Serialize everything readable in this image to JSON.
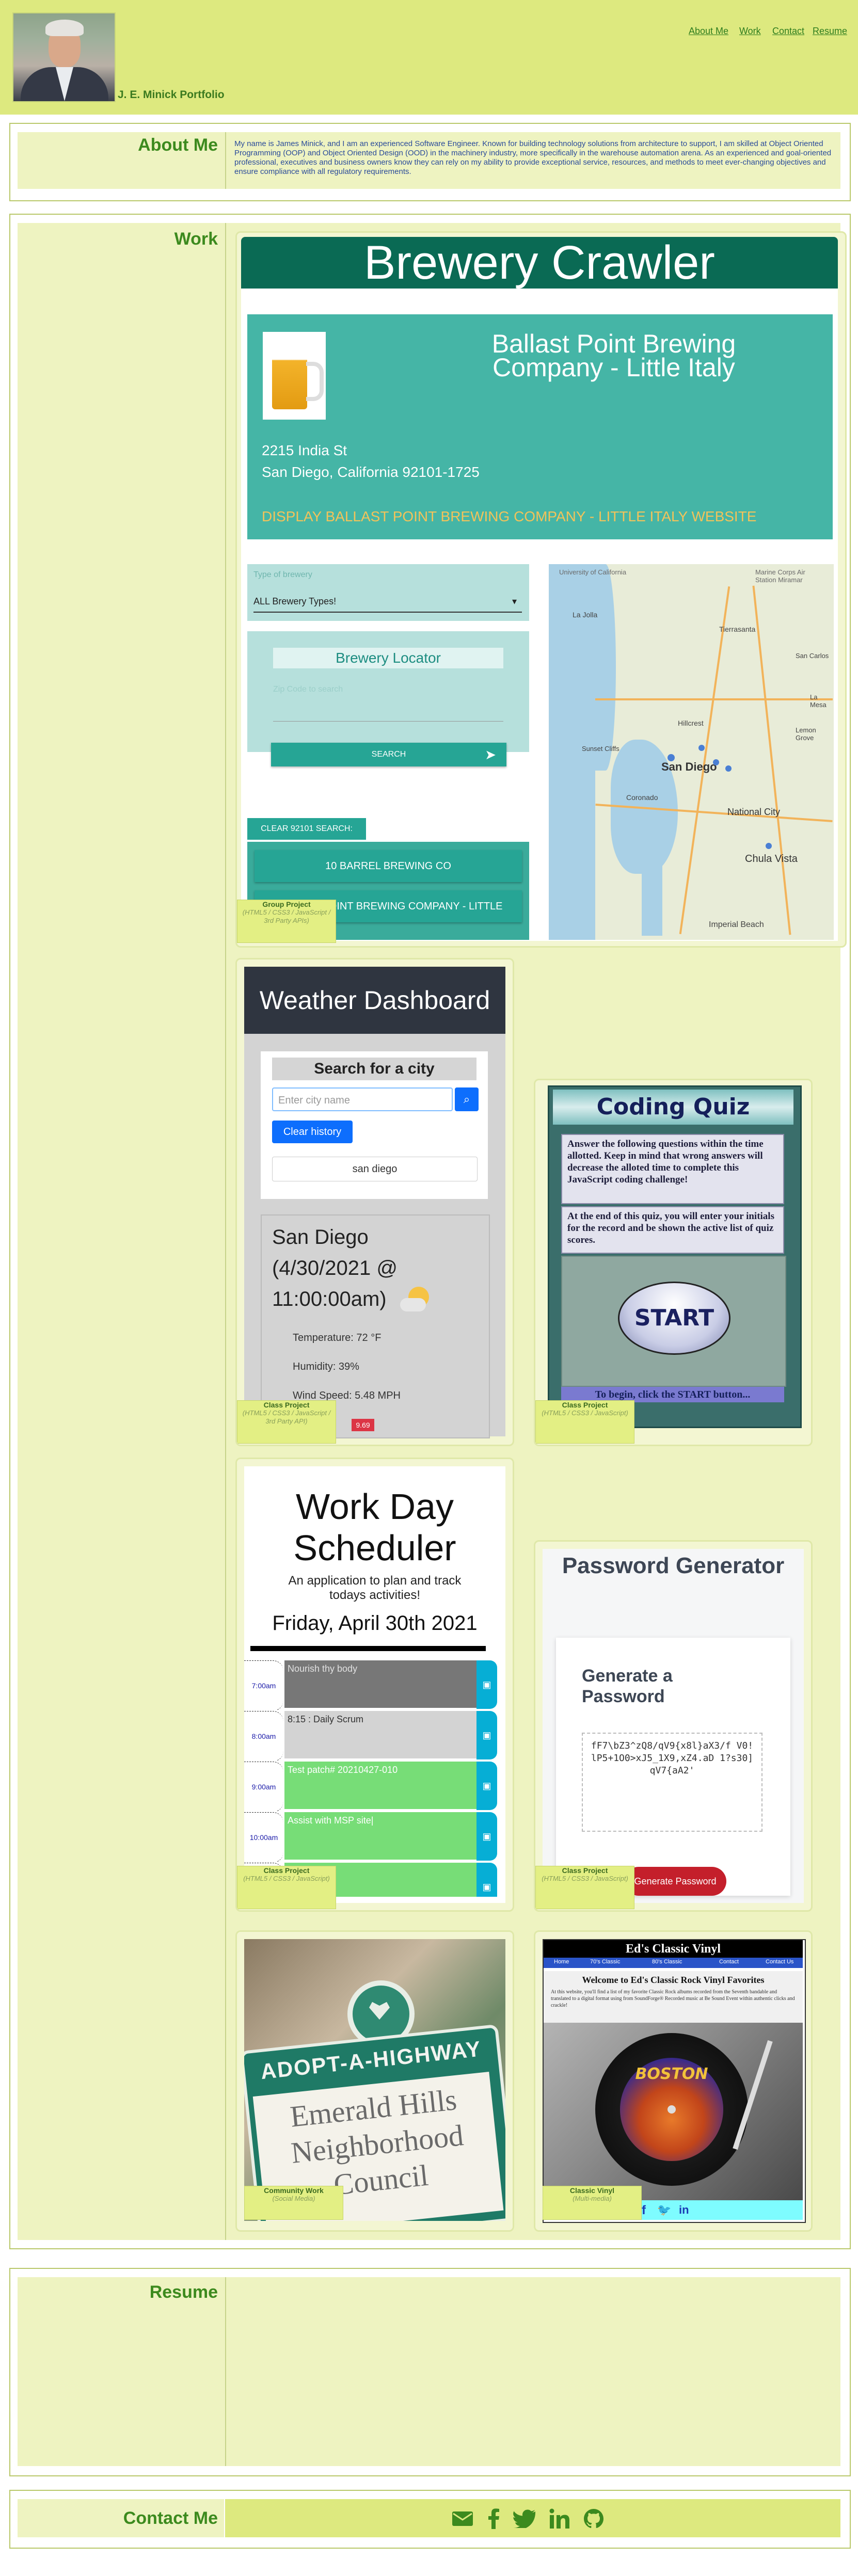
{
  "header": {
    "brand": "J. E. Minick Portfolio",
    "nav": [
      "About Me",
      "Work",
      "Contact",
      "Resume"
    ]
  },
  "about": {
    "heading": "About Me",
    "text": "My name is James Minick, and I am an experienced Software Engineer. Known for building technology solutions from architecture to support, I am skilled at Object Oriented Programming (OOP) and Object Oriented Design (OOD) in the machinery industry, more specifically in the warehouse automation arena. As an experienced and goal-oriented professional, executives and business owners know they can rely on my ability to provide exceptional service, resources, and methods to meet ever-changing objectives and ensure compliance with all regulatory requirements."
  },
  "work": {
    "heading": "Work",
    "brewery": {
      "title": "Brewery Crawler",
      "name": "Ballast Point Brewing Company - Little Italy",
      "address1": "2215 India St",
      "address2": "San Diego, California 92101-1725",
      "link": "DISPLAY BALLAST POINT BREWING COMPANY - LITTLE ITALY WEBSITE",
      "type_label": "Type of brewery",
      "type_value": "ALL Brewery Types!",
      "locator_title": "Brewery Locator",
      "zip_placeholder": "Zip Code to search",
      "search_button": "SEARCH",
      "clear_button": "CLEAR 92101 SEARCH:",
      "results": [
        "10 BARREL BREWING CO",
        "BALLAST POINT BREWING COMPANY - LITTLE"
      ],
      "map_labels": [
        "University of California",
        "Marine Corps Air Station Miramar",
        "La Jolla",
        "Tierrasanta",
        "San Carlos",
        "La Mesa",
        "Hillcrest",
        "Lemon Grove",
        "Sunset Cliffs",
        "San Diego",
        "Coronado",
        "National City",
        "Chula Vista",
        "Imperial Beach"
      ],
      "tag_title": "Group Project",
      "tag_sub": "(HTML5 / CSS3 / JavaScript / 3rd Party APIs)"
    },
    "weather": {
      "title": "Weather Dashboard",
      "search_title": "Search for a city",
      "input_placeholder": "Enter city name",
      "clear_button": "Clear history",
      "history_item": "san diego",
      "city": "San Diego",
      "date": "(4/30/2021 @",
      "time": "11:00:00am)",
      "temp": "Temperature: 72 °F",
      "humidity": "Humidity: 39%",
      "wind": "Wind Speed: 5.48 MPH",
      "uv": "9.69",
      "tag_title": "Class Project",
      "tag_sub": "(HTML5 / CSS3 / JavaScript / 3rd Party API)"
    },
    "quiz": {
      "title": "Coding Quiz",
      "para1": "Answer the following questions within the time allotted. Keep in mind that wrong answers will decrease the alloted time to complete this JavaScript coding challenge!",
      "para2": "At the end of this quiz, you will enter your initials for the record and be shown the active list of quiz scores.",
      "start": "START",
      "footer": "To begin, click the START button...",
      "tag_title": "Class Project",
      "tag_sub": "(HTML5 / CSS3 / JavaScript)"
    },
    "scheduler": {
      "title": "Work Day Scheduler",
      "subtitle": "An application to plan and track todays activities!",
      "date": "Friday, April 30th 2021",
      "rows": [
        {
          "time": "7:00am",
          "text": "Nourish thy body",
          "state": "past"
        },
        {
          "time": "8:00am",
          "text": "8:15 : Daily Scrum",
          "state": "present"
        },
        {
          "time": "9:00am",
          "text": "Test patch# 20210427-010",
          "state": "future"
        },
        {
          "time": "10:00am",
          "text": "Assist with MSP site|",
          "state": "future"
        },
        {
          "time": "11:00am",
          "text": "",
          "state": "future"
        }
      ],
      "tag_title": "Class Project",
      "tag_sub": "(HTML5 / CSS3 / JavaScript)"
    },
    "password": {
      "title": "Password Generator",
      "card_title": "Generate a Password",
      "output": "fF7\\bZ3^zQ8/qV9{x8l}aX3/f V0!lP5+1O0>xJ5_1X9,xZ4.aD 1?s30]qV7{aA2'",
      "button": "Generate Password",
      "tag_title": "Class Project",
      "tag_sub": "(HTML5 / CSS3 / JavaScript)"
    },
    "adopt": {
      "sign_top": "ADOPT-A-HIGHWAY",
      "sign_line1": "Emerald Hills",
      "sign_line2": "Neighborhood",
      "sign_line3": "Council",
      "tag_title": "Community Work",
      "tag_sub": "(Social Media)"
    },
    "vinyl": {
      "title": "Ed's Classic Vinyl",
      "nav": [
        "Home",
        "70's Classic",
        "80's Classic",
        "Contact",
        "Contact Us"
      ],
      "welcome": "Welcome to Ed's Classic Rock Vinyl Favorites",
      "blurb": "At this website, you'll find a list of my favorite Classic Rock albums recorded from the Seventh bandable and translated to a digital format using from SoundForge® Recorded music at Be Sound Event within authentic clicks and crackle!",
      "album": "BOSTON",
      "tag_title": "Classic Vinyl",
      "tag_sub": "(Multi-media)"
    }
  },
  "resume": {
    "heading": "Resume"
  },
  "contact": {
    "heading": "Contact Me",
    "icons": [
      "envelope-icon",
      "facebook-icon",
      "twitter-icon",
      "linkedin-icon",
      "github-icon"
    ]
  },
  "colors": {
    "header_bg": "#dde97f",
    "panel_bg": "#eef3c1",
    "heading_green": "#3c8a1e",
    "brewery_teal": "#45b5a6",
    "brewery_dark": "#0a6a54"
  }
}
